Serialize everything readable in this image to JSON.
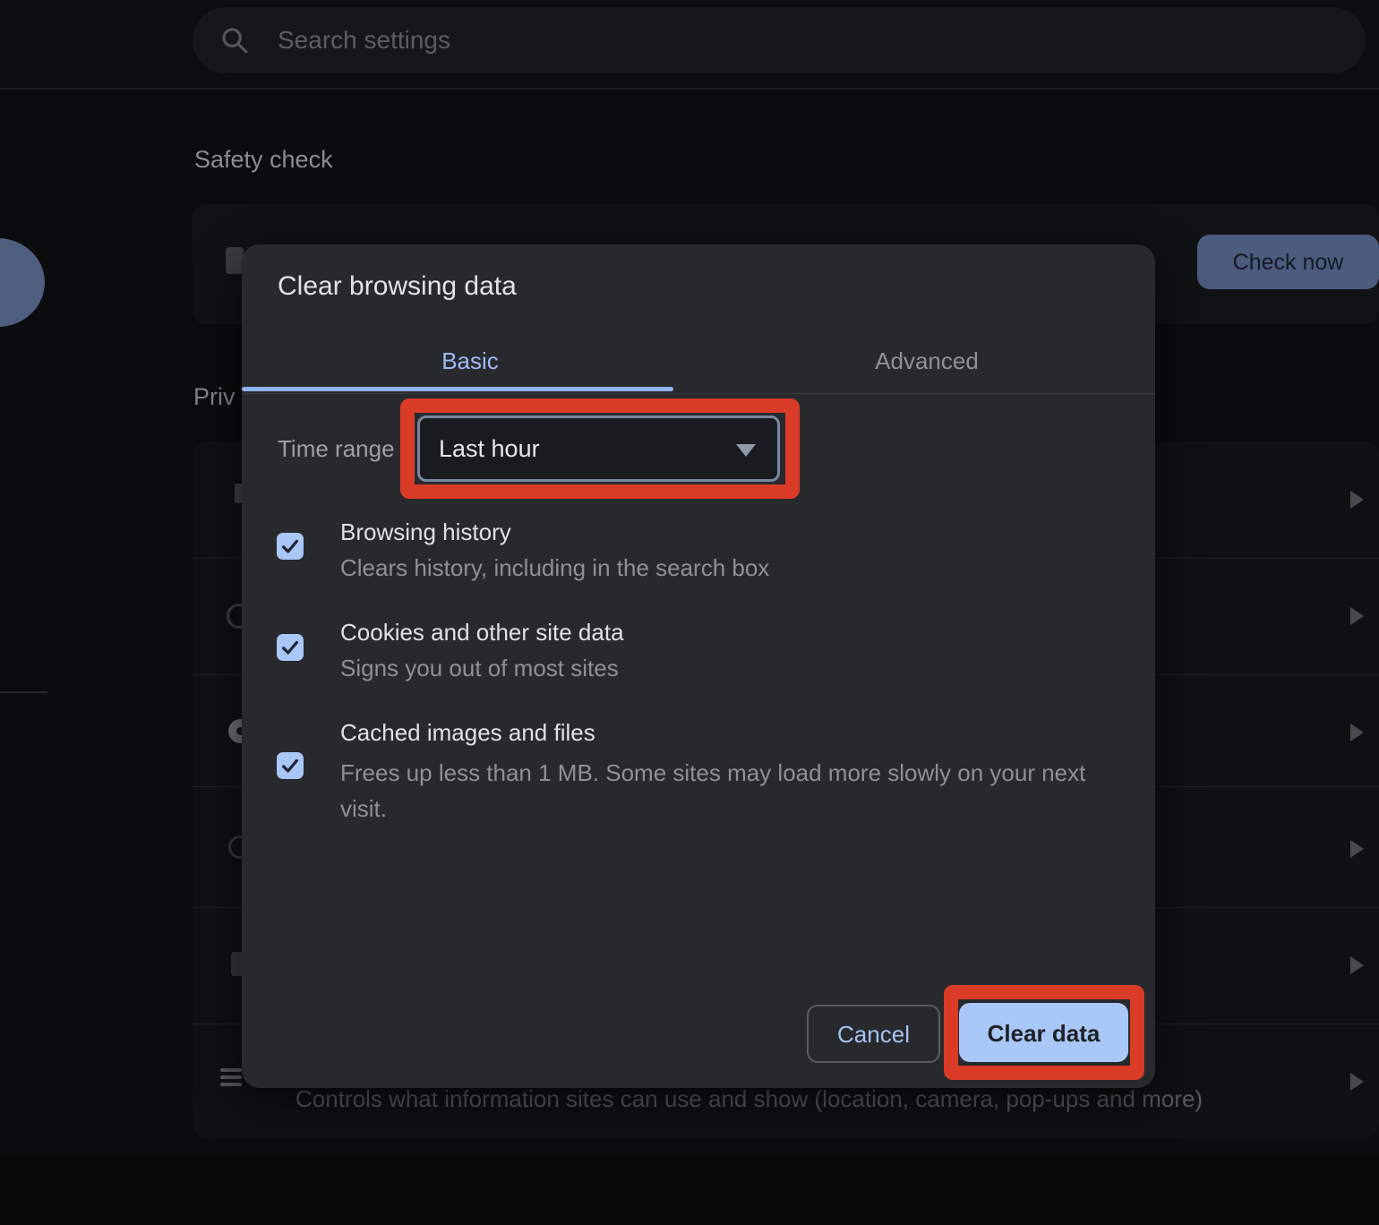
{
  "colors": {
    "annotation_red": "#DA3B26",
    "accent_blue": "#A9C7F7",
    "dialog_background": "#28292D"
  },
  "header": {
    "search_placeholder": "Search settings"
  },
  "page": {
    "safety_check": {
      "title": "Safety check",
      "check_now_label": "Check now"
    },
    "privacy": {
      "partial_heading": "Priv",
      "site_settings_description": "Controls what information sites can use and show (location, camera, pop-ups and more)"
    }
  },
  "dialog": {
    "title": "Clear browsing data",
    "tabs": [
      {
        "label": "Basic",
        "active": true
      },
      {
        "label": "Advanced",
        "active": false
      }
    ],
    "time_range": {
      "label": "Time range",
      "value": "Last hour"
    },
    "checkboxes": [
      {
        "label": "Browsing history",
        "description": "Clears history, including in the search box",
        "checked": true
      },
      {
        "label": "Cookies and other site data",
        "description": "Signs you out of most sites",
        "checked": true
      },
      {
        "label": "Cached images and files",
        "description": "Frees up less than 1 MB. Some sites may load more slowly on your next visit.",
        "checked": true
      }
    ],
    "buttons": {
      "cancel": "Cancel",
      "confirm": "Clear data"
    }
  }
}
